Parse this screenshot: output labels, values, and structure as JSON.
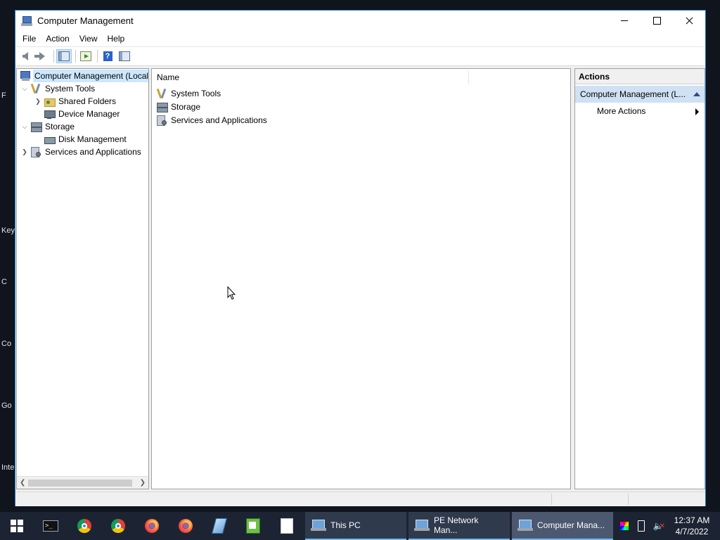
{
  "desktop": {
    "fragments": [
      "F",
      "Key",
      "C",
      "Co",
      "Go",
      "Inte"
    ]
  },
  "window": {
    "title": "Computer Management",
    "menu": [
      "File",
      "Action",
      "View",
      "Help"
    ]
  },
  "tree": {
    "root": "Computer Management (Local",
    "system_tools": "System Tools",
    "shared_folders": "Shared Folders",
    "device_manager": "Device Manager",
    "storage": "Storage",
    "disk_management": "Disk Management",
    "services": "Services and Applications"
  },
  "list": {
    "column_name": "Name",
    "items": [
      "System Tools",
      "Storage",
      "Services and Applications"
    ]
  },
  "actions": {
    "header": "Actions",
    "group": "Computer Management (L...",
    "more_actions": "More Actions"
  },
  "taskbar": {
    "terminal_glyph": ">_",
    "apps": [
      {
        "label": "This PC"
      },
      {
        "label": "PE Network Man..."
      },
      {
        "label": "Computer Mana..."
      }
    ],
    "clock_time": "12:37 AM",
    "clock_date": "4/7/2022"
  },
  "colors": {
    "selection": "#cce8ff",
    "actions_group_bg": "#cfe1f3",
    "window_border": "#1e74c9",
    "taskbar": "#1c2433"
  }
}
